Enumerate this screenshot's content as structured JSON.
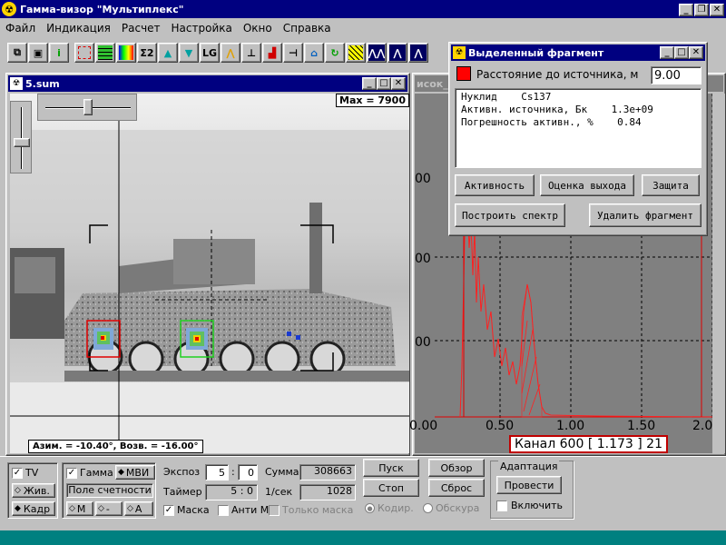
{
  "app": {
    "title": "Гамма-визор \"Мультиплекс\""
  },
  "menu": [
    "Файл",
    "Индикация",
    "Расчет",
    "Настройка",
    "Окно",
    "Справка"
  ],
  "toolbar": {
    "lg_label": "LG",
    "sum_label": "Σ",
    "sum2_label": "Σ2"
  },
  "image_window": {
    "title": "5.sum",
    "max_label": "Max = 7900",
    "azim_label": "Азим. = -10.40°, Возв. = -16.00°"
  },
  "spectrum_window": {
    "title_fragment": "исок_",
    "y_ticks": [
      "00",
      "00",
      "00"
    ],
    "x_ticks": [
      "0.00",
      "0.50",
      "1.00",
      "1.50",
      "2.00"
    ],
    "channel_label": "Канал 600 [ 1.173 ] 21"
  },
  "fragment_window": {
    "title": "Выделенный фрагмент",
    "distance_label": "Расстояние до источника, м",
    "distance_value": "9.00",
    "lines": [
      "Нуклид    Cs137",
      "Активн. источника, Бк    1.3e+09",
      "Погрешность активн., %    0.84"
    ],
    "buttons": {
      "activity": "Активность",
      "yield": "Оценка выхода",
      "protection": "Защита",
      "build_spectrum": "Построить спектр",
      "delete_fragment": "Удалить фрагмент"
    }
  },
  "bottom": {
    "tv": "TV",
    "live": "Жив.",
    "frame": "Кадр",
    "gamma": "Гамма",
    "mvi": "МВИ",
    "count_field": "Поле счетности",
    "m": "М",
    "dash": "-",
    "a": "А",
    "exposure_label": "Экспоз",
    "exposure_min": "5",
    "exposure_sec": "0",
    "timer_label": "Таймер",
    "timer_value": "5 : 0",
    "sum_label": "Сумма",
    "sum_value": "308663",
    "rate_label": "1/сек",
    "rate_value": "1028",
    "mask": "Маска",
    "anti_m": "Анти М",
    "only_mask": "Только маска",
    "start": "Пуск",
    "stop": "Стоп",
    "overview": "Обзор",
    "reset": "Сброс",
    "coded": "Кодир.",
    "obscura": "Обскура",
    "adaptation": "Адаптация",
    "perform": "Провести",
    "enable": "Включить"
  },
  "colors": {
    "title_bar": "#000080",
    "spectrum_line": "#ff2020",
    "accent_red": "#ff0000"
  }
}
